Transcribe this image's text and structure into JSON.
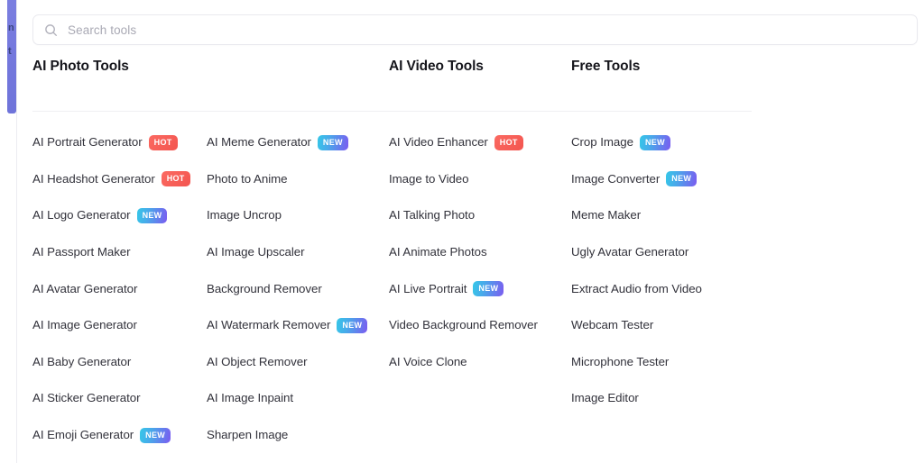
{
  "edge_rail": {
    "fragment_top": "n",
    "fragment_bottom": "t",
    "color": "#7478dd"
  },
  "search": {
    "icon": "search-icon",
    "placeholder": "Search tools",
    "value": ""
  },
  "badges": {
    "hot": "HOT",
    "new": "NEW",
    "hot_color": "#f3554f",
    "new_color_start": "#35c8e8",
    "new_color_end": "#7b5bf0"
  },
  "groups": [
    {
      "title": "AI Photo Tools",
      "columns": [
        [
          {
            "label": "AI Portrait Generator",
            "badge": "HOT"
          },
          {
            "label": "AI Headshot Generator",
            "badge": "HOT"
          },
          {
            "label": "AI Logo Generator",
            "badge": "NEW"
          },
          {
            "label": "AI Passport Maker",
            "badge": ""
          },
          {
            "label": "AI Avatar Generator",
            "badge": ""
          },
          {
            "label": "AI Image Generator",
            "badge": ""
          },
          {
            "label": "AI Baby Generator",
            "badge": ""
          },
          {
            "label": "AI Sticker Generator",
            "badge": ""
          },
          {
            "label": "AI Emoji Generator",
            "badge": "NEW"
          }
        ],
        [
          {
            "label": "AI Meme Generator",
            "badge": "NEW"
          },
          {
            "label": "Photo to Anime",
            "badge": ""
          },
          {
            "label": "Image Uncrop",
            "badge": ""
          },
          {
            "label": "AI Image Upscaler",
            "badge": ""
          },
          {
            "label": "Background Remover",
            "badge": ""
          },
          {
            "label": "AI Watermark Remover",
            "badge": "NEW"
          },
          {
            "label": "AI Object Remover",
            "badge": ""
          },
          {
            "label": "AI Image Inpaint",
            "badge": ""
          },
          {
            "label": "Sharpen Image",
            "badge": ""
          }
        ]
      ]
    },
    {
      "title": "AI Video Tools",
      "columns": [
        [
          {
            "label": "AI Video Enhancer",
            "badge": "HOT"
          },
          {
            "label": "Image to Video",
            "badge": ""
          },
          {
            "label": "AI Talking Photo",
            "badge": ""
          },
          {
            "label": "AI Animate Photos",
            "badge": ""
          },
          {
            "label": "AI Live Portrait",
            "badge": "NEW"
          },
          {
            "label": "Video Background Remover",
            "badge": ""
          },
          {
            "label": "AI Voice Clone",
            "badge": ""
          }
        ]
      ]
    },
    {
      "title": "Free Tools",
      "columns": [
        [
          {
            "label": "Crop Image",
            "badge": "NEW"
          },
          {
            "label": "Image Converter",
            "badge": "NEW"
          },
          {
            "label": "Meme Maker",
            "badge": ""
          },
          {
            "label": "Ugly Avatar Generator",
            "badge": ""
          },
          {
            "label": "Extract Audio from Video",
            "badge": ""
          },
          {
            "label": "Webcam Tester",
            "badge": ""
          },
          {
            "label": "Microphone Tester",
            "badge": ""
          },
          {
            "label": "Image Editor",
            "badge": ""
          }
        ]
      ]
    }
  ]
}
